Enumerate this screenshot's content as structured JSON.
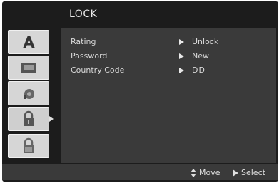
{
  "menu": {
    "title": "LOCK"
  },
  "sidebar": {
    "tabs": [
      {
        "name": "language-icon"
      },
      {
        "name": "display-icon"
      },
      {
        "name": "audio-icon"
      },
      {
        "name": "lock-icon",
        "active": true
      },
      {
        "name": "others-icon"
      }
    ]
  },
  "settings": {
    "rows": [
      {
        "label": "Rating",
        "value": "Unlock"
      },
      {
        "label": "Password",
        "value": "New"
      },
      {
        "label": "Country Code",
        "value": "DD"
      }
    ]
  },
  "footer": {
    "move_label": "Move",
    "select_label": "Select"
  },
  "colors": {
    "background": "#1c1c1c",
    "panel": "#3a3a3a",
    "tab": "#d6d6d6",
    "text": "#d8d8d8"
  }
}
